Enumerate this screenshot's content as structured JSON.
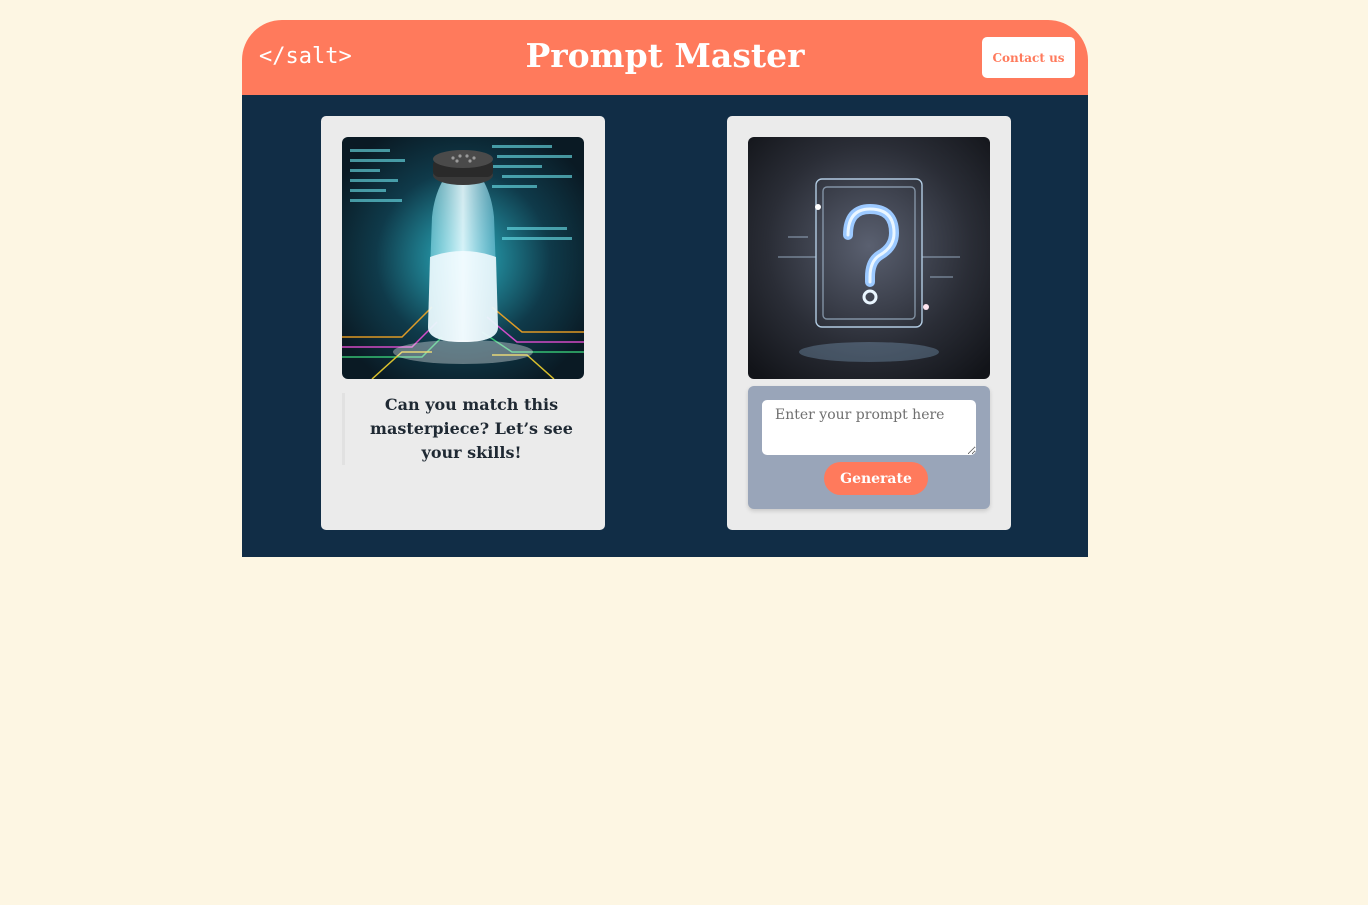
{
  "header": {
    "logo": "</salt>",
    "title": "Prompt Master",
    "contact_label": "Contact us"
  },
  "left_card": {
    "image_icon": "salt-shaker-circuit-image",
    "caption": "Can you match this masterpiece? Let’s see your skills!"
  },
  "right_card": {
    "image_icon": "question-mark-placeholder-image",
    "prompt_placeholder": "Enter your prompt here",
    "generate_label": "Generate"
  },
  "colors": {
    "page_background": "#fdf6e3",
    "accent": "#ff7a5c",
    "main_background": "#112d46",
    "card_background": "#ebebeb",
    "prompt_panel": "#99a5b9"
  }
}
